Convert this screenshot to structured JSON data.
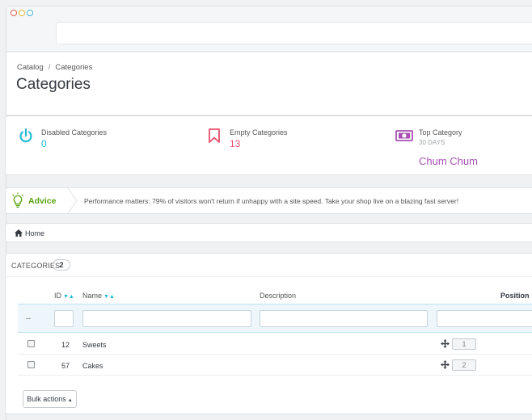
{
  "breadcrumb": {
    "parent": "Catalog",
    "separator": "/",
    "current": "Categories"
  },
  "page": {
    "title": "Categories"
  },
  "kpis": [
    {
      "icon": "power-icon",
      "title": "Disabled Categories",
      "sub": "",
      "value": "0",
      "color": "#25b9d7"
    },
    {
      "icon": "bookmark-icon",
      "title": "Empty Categories",
      "sub": "",
      "value": "13",
      "color": "#e84e6a"
    },
    {
      "icon": "banknote-icon",
      "title": "Top Category",
      "sub": "30 DAYS",
      "value": "Chum Chum",
      "color": "#a651b1"
    }
  ],
  "advice": {
    "label": "Advice",
    "text": "Performance matters: 79% of visitors won't return if unhappy with a site speed. Take your shop live on a blazing fast server!"
  },
  "home": {
    "label": "Home"
  },
  "table": {
    "heading": "CATEGORIES",
    "count": "2",
    "columns": {
      "id": "ID",
      "name": "Name",
      "description": "Description",
      "position": "Position"
    },
    "filter_dash": "--",
    "rows": [
      {
        "id": "12",
        "name": "Sweets",
        "position": "1"
      },
      {
        "id": "57",
        "name": "Cakes",
        "position": "2"
      }
    ],
    "bulk_label": "Bulk actions"
  }
}
